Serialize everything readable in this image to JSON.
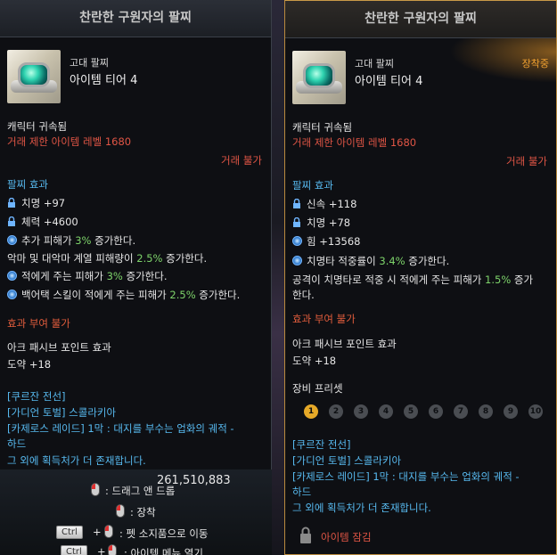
{
  "left": {
    "title": "찬란한 구원자의 팔찌",
    "grade": "고대 팔찌",
    "tier": "아이템 티어 4",
    "bound": "캐릭터 귀속됨",
    "level_req": "거래 제한 아이템 레벨 1680",
    "trade": "거래 불가",
    "effect_header": "팔찌 효과",
    "stat1": "치명 +97",
    "stat2": "체력 +4600",
    "eff1_a": "추가 피해가 ",
    "eff1_b": "3%",
    "eff1_c": " 증가한다.",
    "eff2_a": "악마 및 대악마 계열 피해량이 ",
    "eff2_b": "2.5%",
    "eff2_c": " 증가한다.",
    "eff3_a": "적에게 주는 피해가 ",
    "eff3_b": "3%",
    "eff3_c": " 증가한다.",
    "eff4_a": "백어택 스킬이 적에게 주는 피해가 ",
    "eff4_b": "2.5%",
    "eff4_c": " 증가한다.",
    "no_effect": "효과 부여 불가",
    "ark": "아크 패시브 포인트 효과",
    "leap": "도약 +18",
    "src1": "[쿠르잔 전선]",
    "src2": "[가디언 토벌] 스콜라키아",
    "src3a": "[카제로스 레이드] 1막 : 대지를 부수는 업화의 궤적 -",
    "src3b": "하드",
    "src4": "그 외에 획득처가 더 존재합니다.",
    "gold": "261,510,883",
    "hint_drag": ": 드래그 앤 드롭",
    "hint_equip": ": 장착",
    "hint_pet": ": 펫 소지품으로 이동",
    "hint_menu": ": 아이템 메뉴 열기",
    "ctrl": "Ctrl",
    "plus": "+"
  },
  "right": {
    "title": "찬란한 구원자의 팔찌",
    "grade": "고대 팔찌",
    "tier": "아이템 티어 4",
    "equipped": "장착중",
    "bound": "캐릭터 귀속됨",
    "level_req": "거래 제한 아이템 레벨 1680",
    "trade": "거래 불가",
    "effect_header": "팔찌 효과",
    "stat1": "신속 +118",
    "stat2": "치명 +78",
    "stat3": "힘 +13568",
    "eff1_a": "치명타 적중률이 ",
    "eff1_b": "3.4%",
    "eff1_c": " 증가한다.",
    "eff2_a": "공격이 치명타로 적중 시 적에게 주는 피해가 ",
    "eff2_b": "1.5%",
    "eff2_c": " 증가",
    "eff2_d": "한다.",
    "no_effect": "효과 부여 불가",
    "ark": "아크 패시브 포인트 효과",
    "leap": "도약 +18",
    "preset": "장비 프리셋",
    "presets": [
      "1",
      "2",
      "3",
      "4",
      "5",
      "6",
      "7",
      "8",
      "9",
      "10"
    ],
    "src1": "[쿠르잔 전선]",
    "src2": "[가디언 토벌] 스콜라키아",
    "src3a": "[카제로스 레이드] 1막 : 대지를 부수는 업화의 궤적 -",
    "src3b": "하드",
    "src4": "그 외에 획득처가 더 존재합니다.",
    "locked": "아이템 잠김"
  }
}
